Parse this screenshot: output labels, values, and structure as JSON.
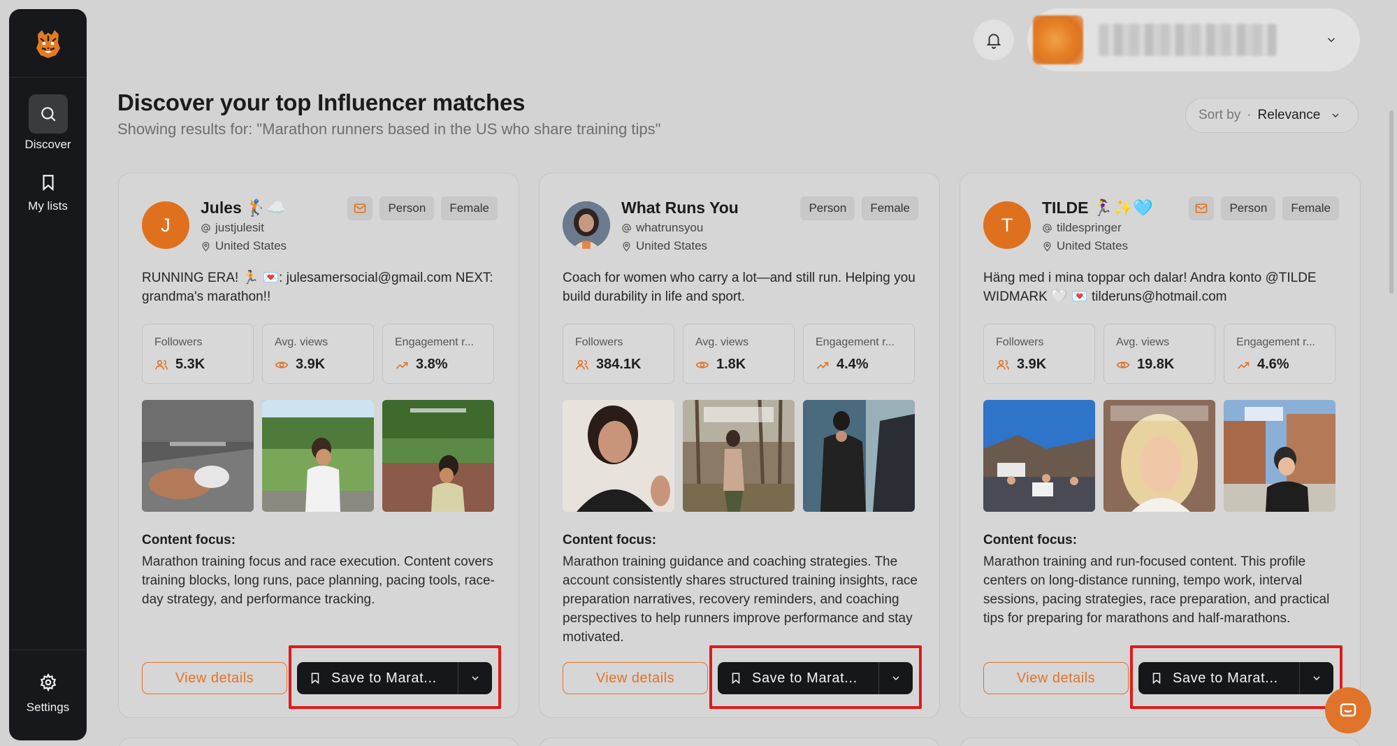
{
  "sidebar": {
    "items": [
      {
        "label": "Discover",
        "icon": "search-icon"
      },
      {
        "label": "My lists",
        "icon": "bookmark-icon"
      },
      {
        "label": "Settings",
        "icon": "gear-icon"
      }
    ]
  },
  "header": {
    "title": "Discover your top Influencer matches",
    "subtitle": "Showing results for: \"Marathon runners based in the US who share training tips\"",
    "sort": {
      "label": "Sort by",
      "separator": "·",
      "value": "Relevance"
    }
  },
  "labels": {
    "followers": "Followers",
    "avg_views": "Avg. views",
    "engagement": "Engagement r...",
    "content_focus": "Content focus:",
    "view_details": "View details"
  },
  "cards": [
    {
      "initial": "J",
      "name": "Jules 🏌️☁️",
      "handle": "justjulesit",
      "location": "United States",
      "tags": [
        "Person",
        "Female"
      ],
      "has_email": true,
      "bio": "RUNNING ERA! 🏃 💌: julesamersocial@gmail.com NEXT: grandma's marathon!!",
      "followers": "5.3K",
      "avg_views": "3.9K",
      "engagement": "3.8%",
      "content_focus": "Marathon training focus and race execution. Content covers training blocks, long runs, pace planning, pacing tools, race-day strategy, and performance tracking.",
      "save_label": "Save to Marat..."
    },
    {
      "initial": "",
      "name": "What Runs You",
      "handle": "whatrunsyou",
      "location": "United States",
      "tags": [
        "Person",
        "Female"
      ],
      "has_email": false,
      "bio": "Coach for women who carry a lot—and still run. Helping you build durability in life and sport.",
      "followers": "384.1K",
      "avg_views": "1.8K",
      "engagement": "4.4%",
      "content_focus": "Marathon training guidance and coaching strategies. The account consistently shares structured training insights, race preparation narratives, recovery reminders, and coaching perspectives to help runners improve performance and stay motivated.",
      "save_label": "Save to Marat..."
    },
    {
      "initial": "T",
      "name": "TILDE 🏃‍♀️✨🩵",
      "handle": "tildespringer",
      "location": "United States",
      "tags": [
        "Person",
        "Female"
      ],
      "has_email": true,
      "bio": "Häng med i mina toppar och dalar! Andra konto @TILDE WIDMARK 🤍 💌 tilderuns@hotmail.com",
      "followers": "3.9K",
      "avg_views": "19.8K",
      "engagement": "4.6%",
      "content_focus": "Marathon training and run-focused content. This profile centers on long-distance running, tempo work, interval sessions, pacing strategies, race preparation, and practical tips for preparing for marathons and half-marathons.",
      "save_label": "Save to Marat..."
    }
  ],
  "colors": {
    "accent": "#e0742a",
    "sidebar": "#17181b",
    "highlight": "#e11a1a"
  }
}
